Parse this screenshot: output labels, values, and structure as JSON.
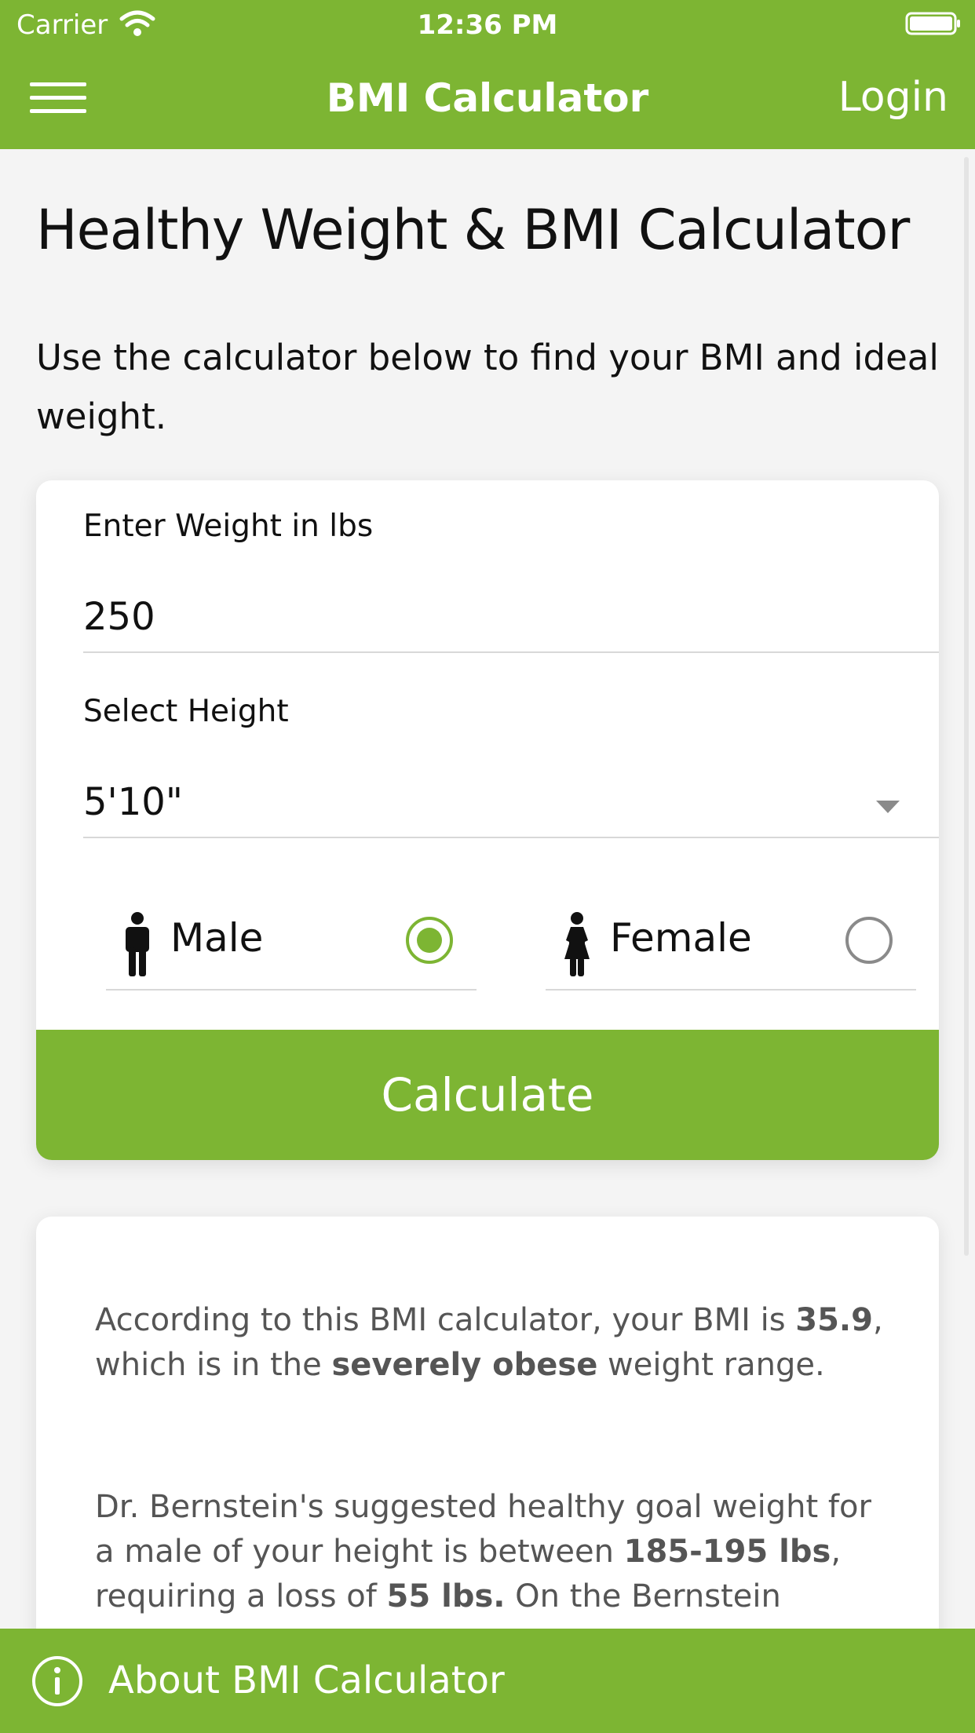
{
  "status_bar": {
    "carrier": "Carrier",
    "time": "12:36 PM"
  },
  "nav": {
    "title": "BMI Calculator",
    "login_label": "Login"
  },
  "page": {
    "title": "Healthy Weight & BMI Calculator",
    "intro": "Use the calculator below to find your BMI and ideal weight."
  },
  "form": {
    "weight_label": "Enter Weight in lbs",
    "weight_value": "250",
    "height_label": "Select Height",
    "height_value": "5'10\"",
    "gender_male": "Male",
    "gender_female": "Female",
    "selected_gender": "Male",
    "calculate_label": "Calculate"
  },
  "result": {
    "p1_a": "According to this BMI calculator, your BMI is ",
    "bmi": "35.9",
    "p1_b": ", which is in the ",
    "category": "severely obese",
    "p1_c": " weight range.",
    "p2_a": "Dr. Bernstein's suggested healthy goal weight for a male of your height is between ",
    "goal_range": "185-195 lbs",
    "p2_b": ", requiring a loss of ",
    "loss": "55 lbs.",
    "p2_c": " On the Bernstein"
  },
  "bottom_bar": {
    "label": "About BMI Calculator"
  },
  "colors": {
    "brand": "#7db533",
    "background": "#f4f4f4"
  },
  "icons": [
    "wifi-icon",
    "battery-icon",
    "menu-icon",
    "male-icon",
    "female-icon",
    "chevron-down-icon",
    "info-icon"
  ]
}
